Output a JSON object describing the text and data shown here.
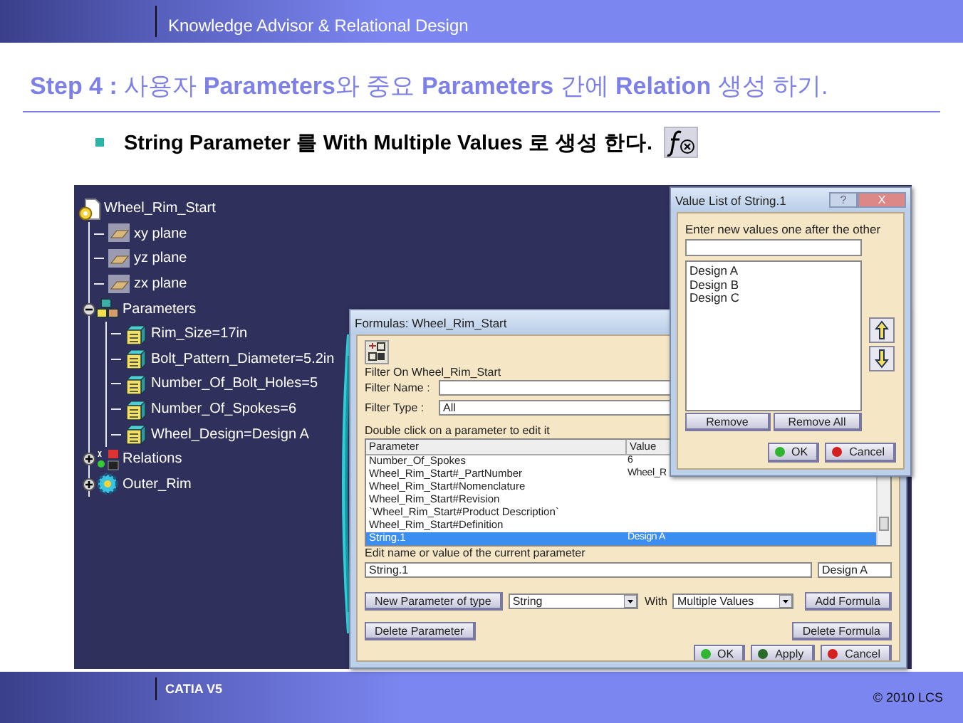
{
  "header": {
    "title": "Knowledge Advisor & Relational Design"
  },
  "slide_title": "**Step 4 :** 사용자 **Parameters**와 중요 **Parameters** 간에 **Relation** 생성 하기.",
  "bullet": {
    "text": "String Parameter 를 With Multiple Values 로 생성 한다."
  },
  "tree": {
    "label": "Wheel_Rim_Start",
    "kind": "part",
    "children": [
      {
        "label": "xy plane",
        "kind": "plane"
      },
      {
        "label": "yz plane",
        "kind": "plane"
      },
      {
        "label": "zx plane",
        "kind": "plane"
      },
      {
        "label": "Parameters",
        "kind": "parameters",
        "expanded": true,
        "children": [
          {
            "label": "Rim_Size=17in",
            "kind": "parameter"
          },
          {
            "label": "Bolt_Pattern_Diameter=5.2in",
            "kind": "parameter"
          },
          {
            "label": "Number_Of_Bolt_Holes=5",
            "kind": "parameter"
          },
          {
            "label": "Number_Of_Spokes=6",
            "kind": "parameter"
          },
          {
            "label": "Wheel_Design=Design A",
            "kind": "parameter"
          }
        ]
      },
      {
        "label": "Relations",
        "kind": "relations",
        "expanded": false
      },
      {
        "label": "Outer_Rim",
        "kind": "body",
        "expanded": false
      }
    ]
  },
  "formulas_dialog": {
    "title": "Formulas: Wheel_Rim_Start",
    "filter_on": "Filter On Wheel_Rim_Start",
    "filter_name_label": "Filter Name :",
    "filter_type": {
      "label": "Filter Type :",
      "value": "All"
    },
    "table_hint": "Double click on a parameter to edit it",
    "table": {
      "columns": [
        "Parameter",
        "Value"
      ],
      "rows": [
        {
          "cells": [
            "Number_Of_Spokes",
            "6"
          ],
          "selected": false
        },
        {
          "cells": [
            "Wheel_Rim_Start#_PartNumber",
            "Wheel_R"
          ],
          "selected": false
        },
        {
          "cells": [
            "Wheel_Rim_Start#Nomenclature"
          ],
          "selected": false
        },
        {
          "cells": [
            "Wheel_Rim_Start#Revision"
          ],
          "selected": false
        },
        {
          "cells": [
            "`Wheel_Rim_Start#Product Description`"
          ],
          "selected": false
        },
        {
          "cells": [
            "Wheel_Rim_Start#Definition"
          ],
          "selected": false
        },
        {
          "cells": [
            "String.1",
            "Design A"
          ],
          "selected": true
        }
      ]
    },
    "edit_label": "Edit name or value of the current parameter",
    "edit_name": "String.1",
    "edit_value": "Design A",
    "new_parameter_button": "New Parameter of type",
    "type_select": "String",
    "with_label": "With",
    "with_select": "Multiple Values",
    "add_formula_button": "Add Formula",
    "delete_parameter_button": "Delete Parameter",
    "delete_formula_button": "Delete Formula",
    "footer_buttons": [
      {
        "label": "OK",
        "kind": "ok"
      },
      {
        "label": "Apply",
        "kind": "apply"
      },
      {
        "label": "Cancel",
        "kind": "cancel"
      }
    ]
  },
  "value_list_dialog": {
    "title": "Value List of String.1",
    "help_button": "?",
    "close_button": "X",
    "prompt": "Enter new values one after the other",
    "values": [
      "Design A",
      "Design B",
      "Design C"
    ],
    "remove_button": "Remove",
    "remove_all_button": "Remove All",
    "footer_buttons": [
      {
        "label": "OK",
        "kind": "ok"
      },
      {
        "label": "Cancel",
        "kind": "cancel"
      }
    ]
  },
  "footer": {
    "product": "CATIA V5",
    "copyright": "© 2010 LCS"
  }
}
